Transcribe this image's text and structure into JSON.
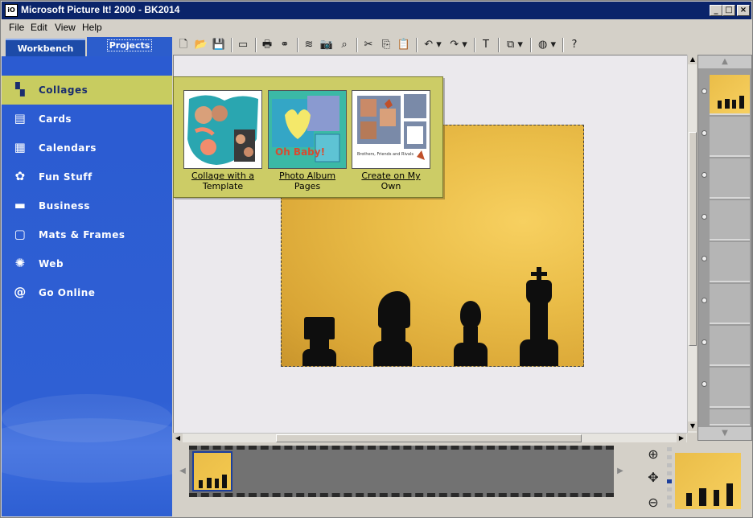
{
  "window": {
    "title": "Microsoft Picture It! 2000 - BK2014",
    "icon_text": "iO"
  },
  "menu": [
    "File",
    "Edit",
    "View",
    "Help"
  ],
  "tabs": {
    "workbench": "Workbench",
    "projects": "Projects"
  },
  "nav": [
    {
      "label": "Collages",
      "icon": "collage-icon",
      "glyph": "▚",
      "selected": true
    },
    {
      "label": "Cards",
      "icon": "card-icon",
      "glyph": "▤",
      "selected": false
    },
    {
      "label": "Calendars",
      "icon": "calendar-icon",
      "glyph": "▦",
      "selected": false
    },
    {
      "label": "Fun Stuff",
      "icon": "flower-icon",
      "glyph": "✿",
      "selected": false
    },
    {
      "label": "Business",
      "icon": "briefcase-icon",
      "glyph": "▬",
      "selected": false
    },
    {
      "label": "Mats & Frames",
      "icon": "frame-icon",
      "glyph": "▢",
      "selected": false
    },
    {
      "label": "Web",
      "icon": "spiderweb-icon",
      "glyph": "✺",
      "selected": false
    },
    {
      "label": "Go Online",
      "icon": "at-sign-icon",
      "glyph": "@",
      "selected": false
    }
  ],
  "toolbar": [
    {
      "name": "new-icon",
      "glyph": "🗋"
    },
    {
      "name": "open-folder-icon",
      "glyph": "📂"
    },
    {
      "name": "save-icon",
      "glyph": "💾"
    },
    {
      "name": "sep"
    },
    {
      "name": "scan-icon",
      "glyph": "▭"
    },
    {
      "name": "sep"
    },
    {
      "name": "print-icon",
      "glyph": "🖶"
    },
    {
      "name": "find-binoculars-icon",
      "glyph": "⚭"
    },
    {
      "name": "sep"
    },
    {
      "name": "stack-icon",
      "glyph": "≋"
    },
    {
      "name": "camera-icon",
      "glyph": "📷"
    },
    {
      "name": "zoom-select-icon",
      "glyph": "⌕"
    },
    {
      "name": "sep"
    },
    {
      "name": "cut-icon",
      "glyph": "✂"
    },
    {
      "name": "copy-icon",
      "glyph": "⎘"
    },
    {
      "name": "paste-icon",
      "glyph": "📋"
    },
    {
      "name": "sep"
    },
    {
      "name": "undo-icon",
      "glyph": "↶ ▾"
    },
    {
      "name": "redo-icon",
      "glyph": "↷ ▾"
    },
    {
      "name": "sep"
    },
    {
      "name": "text-icon",
      "glyph": "T"
    },
    {
      "name": "sep"
    },
    {
      "name": "arrange-icon",
      "glyph": "⧉ ▾"
    },
    {
      "name": "sep"
    },
    {
      "name": "web-globe-icon",
      "glyph": "◍ ▾"
    },
    {
      "name": "sep"
    },
    {
      "name": "help-icon",
      "glyph": "?"
    }
  ],
  "popup": {
    "items": [
      {
        "line1": "Collage with a",
        "line2": "Template"
      },
      {
        "line1": "Photo Album",
        "line2": "Pages"
      },
      {
        "line1": "Create on My",
        "line2": "Own"
      }
    ],
    "card2_text": "Oh Baby!",
    "card3_text": "Brothers, Friends and Rivals"
  },
  "colors": {
    "titlebar": "#0a246a",
    "panel": "#2f60d4",
    "selected": "#c8cc60",
    "photo": "#eabd48"
  }
}
